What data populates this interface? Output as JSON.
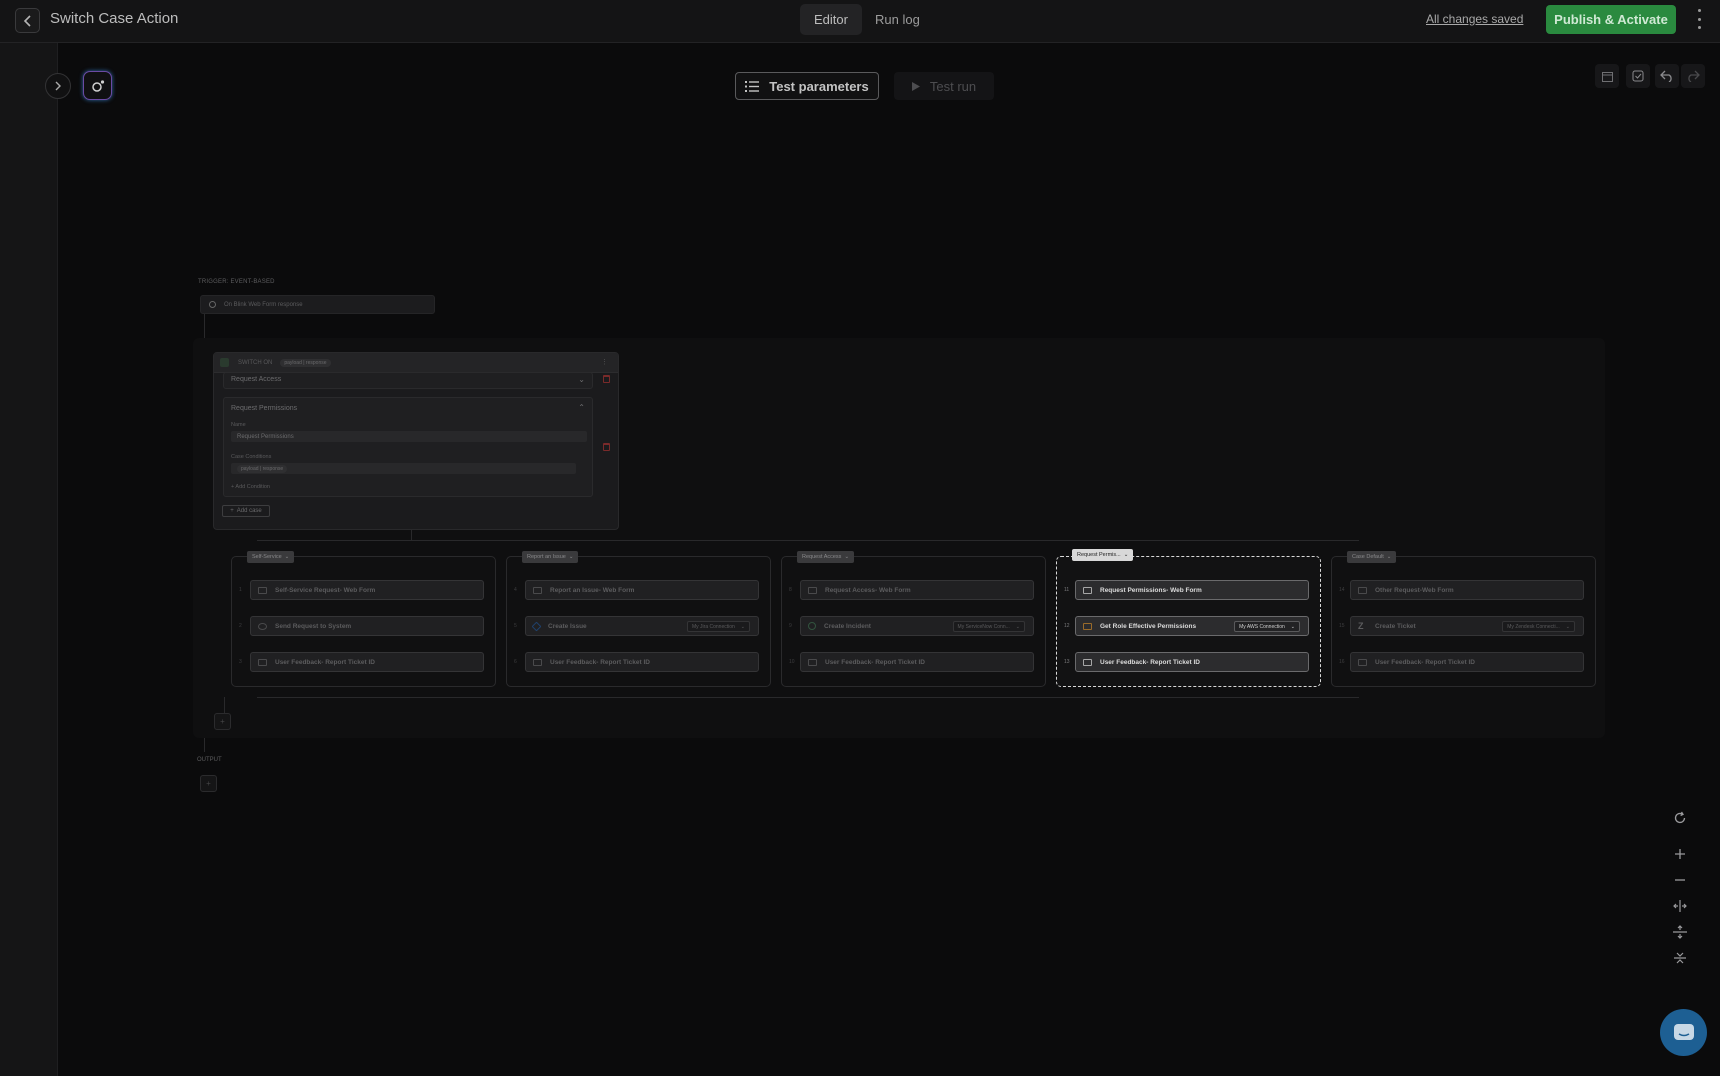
{
  "header": {
    "title": "Switch Case Action",
    "tabs": [
      {
        "label": "Editor",
        "active": true
      },
      {
        "label": "Run log",
        "active": false
      }
    ],
    "saved_status": "All changes saved",
    "publish_label": "Publish & Activate"
  },
  "toolbar": {
    "test_parameters_label": "Test parameters",
    "test_run_label": "Test run"
  },
  "flow": {
    "trigger_label": "TRIGGER: EVENT-BASED",
    "trigger_node_text": "On Blink Web Form response",
    "switch": {
      "title": "SWITCH ON",
      "variable": "payload | response",
      "collapsed_case": "Request Access",
      "expanded_case": {
        "header": "Request Permissions",
        "name_label": "Name",
        "name_value": "Request Permissions",
        "conditions_label": "Case Conditions",
        "condition_chip": "payload | response",
        "add_condition": "+ Add Condition"
      },
      "add_case_label": "Add case"
    },
    "branches": [
      {
        "tag": "Self-Service",
        "active": false,
        "steps": [
          {
            "num": "1",
            "label": "Self-Service Request- Web Form",
            "icon": "form-icon"
          },
          {
            "num": "2",
            "label": "Send Request to System",
            "icon": "wrench-icon"
          },
          {
            "num": "3",
            "label": "User Feedback- Report Ticket ID",
            "icon": "form-icon"
          }
        ]
      },
      {
        "tag": "Report an Issue",
        "active": false,
        "steps": [
          {
            "num": "4",
            "label": "Report an Issue- Web Form",
            "icon": "form-icon"
          },
          {
            "num": "5",
            "label": "Create Issue",
            "icon": "jira-icon",
            "connection": "My Jira Connection"
          },
          {
            "num": "6",
            "label": "User Feedback- Report Ticket ID",
            "icon": "form-icon"
          }
        ]
      },
      {
        "tag": "Request Access",
        "active": false,
        "steps": [
          {
            "num": "8",
            "label": "Request Access- Web Form",
            "icon": "form-icon"
          },
          {
            "num": "9",
            "label": "Create Incident",
            "icon": "servicenow-icon",
            "connection": "My ServiceNow Conn..."
          },
          {
            "num": "10",
            "label": "User Feedback- Report Ticket ID",
            "icon": "form-icon"
          }
        ]
      },
      {
        "tag": "Request Permis...",
        "active": true,
        "steps": [
          {
            "num": "11",
            "label": "Request Permissions- Web Form",
            "icon": "form-icon"
          },
          {
            "num": "12",
            "label": "Get Role Effective Permissions",
            "icon": "aws-icon",
            "connection": "My AWS Connection"
          },
          {
            "num": "13",
            "label": "User Feedback- Report Ticket ID",
            "icon": "form-icon"
          }
        ]
      },
      {
        "tag": "Case Default",
        "active": false,
        "steps": [
          {
            "num": "14",
            "label": "Other Request-Web Form",
            "icon": "form-icon"
          },
          {
            "num": "15",
            "label": "Create Ticket",
            "icon": "zendesk-icon",
            "connection": "My Zendesk Connecti..."
          },
          {
            "num": "16",
            "label": "User Feedback- Report Ticket ID",
            "icon": "form-icon"
          }
        ]
      }
    ],
    "output_label": "OUTPUT"
  },
  "colors": {
    "publish": "#2a8a3f",
    "chat": "#1d5f93",
    "active_branch": "#d8d8d8"
  }
}
